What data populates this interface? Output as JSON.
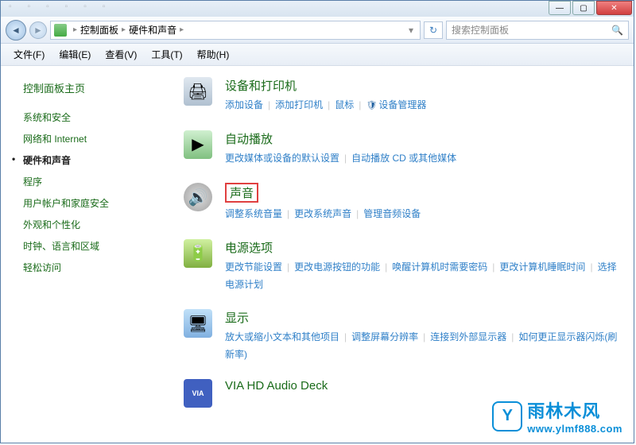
{
  "window": {
    "min": "—",
    "max": "▢",
    "close": "✕"
  },
  "breadcrumb": {
    "root_sep": "▸",
    "items": [
      "控制面板",
      "硬件和声音"
    ],
    "dropdown": "▾"
  },
  "refresh_icon": "↻",
  "search": {
    "placeholder": "搜索控制面板",
    "icon": "🔍"
  },
  "menubar": [
    "文件(F)",
    "编辑(E)",
    "查看(V)",
    "工具(T)",
    "帮助(H)"
  ],
  "sidebar": {
    "header": "控制面板主页",
    "items": [
      {
        "label": "系统和安全",
        "active": false
      },
      {
        "label": "网络和 Internet",
        "active": false
      },
      {
        "label": "硬件和声音",
        "active": true
      },
      {
        "label": "程序",
        "active": false
      },
      {
        "label": "用户帐户和家庭安全",
        "active": false
      },
      {
        "label": "外观和个性化",
        "active": false
      },
      {
        "label": "时钟、语言和区域",
        "active": false
      },
      {
        "label": "轻松访问",
        "active": false
      }
    ]
  },
  "categories": [
    {
      "icon": "printer",
      "glyph": "🖨",
      "title": "设备和打印机",
      "links": [
        {
          "text": "添加设备"
        },
        {
          "text": "添加打印机"
        },
        {
          "text": "鼠标"
        },
        {
          "text": "设备管理器",
          "shield": true
        }
      ]
    },
    {
      "icon": "autoplay",
      "glyph": "▶",
      "title": "自动播放",
      "links": [
        {
          "text": "更改媒体或设备的默认设置"
        },
        {
          "text": "自动播放 CD 或其他媒体"
        }
      ]
    },
    {
      "icon": "sound",
      "glyph": "🔊",
      "title": "声音",
      "highlighted": true,
      "links": [
        {
          "text": "调整系统音量"
        },
        {
          "text": "更改系统声音"
        },
        {
          "text": "管理音频设备"
        }
      ]
    },
    {
      "icon": "power",
      "glyph": "🔋",
      "title": "电源选项",
      "links": [
        {
          "text": "更改节能设置"
        },
        {
          "text": "更改电源按钮的功能"
        },
        {
          "text": "唤醒计算机时需要密码"
        },
        {
          "text": "更改计算机睡眠时间"
        },
        {
          "text": "选择电源计划"
        }
      ]
    },
    {
      "icon": "display",
      "glyph": "🖥",
      "title": "显示",
      "links": [
        {
          "text": "放大或缩小文本和其他项目"
        },
        {
          "text": "调整屏幕分辨率"
        },
        {
          "text": "连接到外部显示器"
        },
        {
          "text": "如何更正显示器闪烁(刷新率)"
        }
      ]
    },
    {
      "icon": "via",
      "glyph": "VIA",
      "title": "VIA HD Audio Deck",
      "links": []
    }
  ],
  "watermark": {
    "icon": "Y",
    "line1": "雨林木风",
    "line2": "www.ylmf888.com"
  }
}
